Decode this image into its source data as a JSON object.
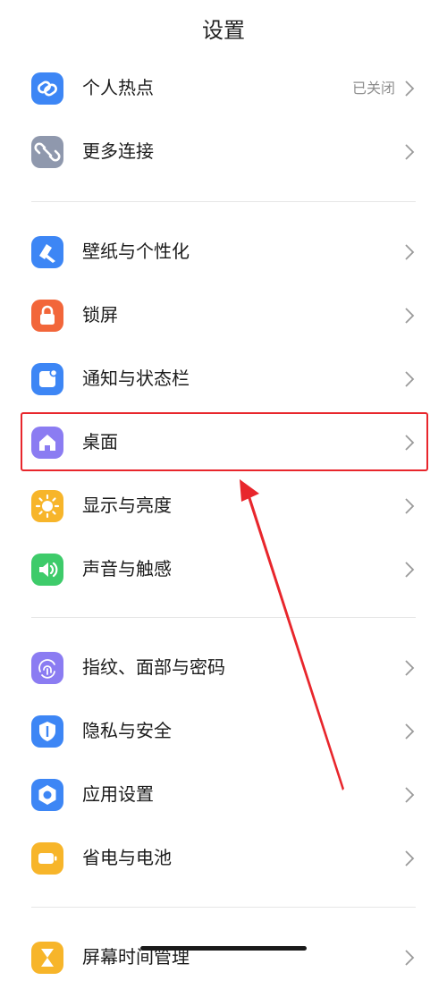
{
  "header": {
    "title": "设置"
  },
  "items": [
    {
      "id": "hotspot",
      "label": "个人热点",
      "value": "已关闭",
      "icon": "hotspot-link-icon",
      "color": "#3d86f5"
    },
    {
      "id": "more-connections",
      "label": "更多连接",
      "value": "",
      "icon": "link-icon",
      "color": "#8f98ad"
    },
    {
      "id": "wallpaper",
      "label": "壁纸与个性化",
      "value": "",
      "icon": "brush-icon",
      "color": "#3d86f5"
    },
    {
      "id": "lockscreen",
      "label": "锁屏",
      "value": "",
      "icon": "lock-icon",
      "color": "#f2663a"
    },
    {
      "id": "notifications",
      "label": "通知与状态栏",
      "value": "",
      "icon": "notification-icon",
      "color": "#3d86f5"
    },
    {
      "id": "desktop",
      "label": "桌面",
      "value": "",
      "icon": "home-icon",
      "color": "#8b7cf2"
    },
    {
      "id": "display",
      "label": "显示与亮度",
      "value": "",
      "icon": "sun-icon",
      "color": "#f7b52a"
    },
    {
      "id": "sound",
      "label": "声音与触感",
      "value": "",
      "icon": "speaker-icon",
      "color": "#3ecb6a"
    },
    {
      "id": "biometrics",
      "label": "指纹、面部与密码",
      "value": "",
      "icon": "fingerprint-icon",
      "color": "#8b7cf2"
    },
    {
      "id": "privacy",
      "label": "隐私与安全",
      "value": "",
      "icon": "shield-icon",
      "color": "#3d86f5"
    },
    {
      "id": "apps",
      "label": "应用设置",
      "value": "",
      "icon": "hexagon-icon",
      "color": "#3d86f5"
    },
    {
      "id": "battery",
      "label": "省电与电池",
      "value": "",
      "icon": "battery-icon",
      "color": "#f7b52a"
    },
    {
      "id": "screen-time",
      "label": "屏幕时间管理",
      "value": "",
      "icon": "hourglass-icon",
      "color": "#f7b52a"
    }
  ],
  "annotation": {
    "highlight_color": "#e8262c",
    "highlighted_item": "desktop"
  }
}
